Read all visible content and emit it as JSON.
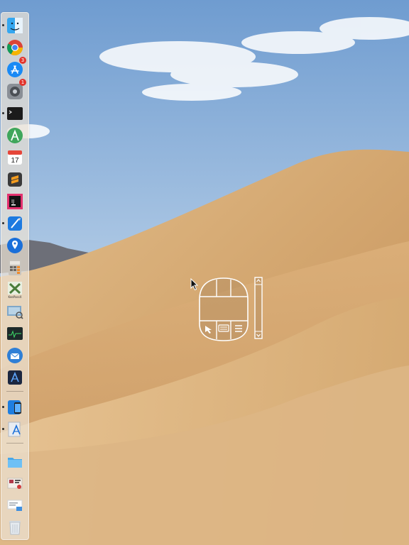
{
  "screen": {
    "wallpaper": "desert-dunes",
    "sky_color": "#8fb4d8",
    "sand_color": "#d7ad78"
  },
  "dock": {
    "items": [
      {
        "name": "finder",
        "icon": "finder-icon",
        "running": true
      },
      {
        "name": "chrome",
        "icon": "chrome-icon",
        "running": true
      },
      {
        "name": "app-store",
        "icon": "app-store-icon",
        "running": false,
        "badge": "3"
      },
      {
        "name": "system-preferences",
        "icon": "gear-icon",
        "running": false,
        "badge": "1"
      },
      {
        "name": "terminal",
        "icon": "terminal-icon",
        "running": true
      },
      {
        "name": "android-studio",
        "icon": "android-studio-icon",
        "running": false
      },
      {
        "name": "calendar",
        "icon": "calendar-icon",
        "running": false,
        "text": "17"
      },
      {
        "name": "sublime-text",
        "icon": "sublime-icon",
        "running": false
      },
      {
        "name": "intellij",
        "icon": "intellij-icon",
        "running": false
      },
      {
        "name": "xcode",
        "icon": "xcode-icon",
        "running": true
      },
      {
        "name": "maps-pin",
        "icon": "pin-icon",
        "running": false
      },
      {
        "name": "calculator",
        "icon": "calculator-icon",
        "running": false
      },
      {
        "name": "keypoint",
        "icon": "keypoint-icon",
        "running": false,
        "text": "KeePassX"
      },
      {
        "name": "preview",
        "icon": "preview-icon",
        "running": false
      },
      {
        "name": "activity-monitor",
        "icon": "activity-monitor-icon",
        "running": false
      },
      {
        "name": "thunderbird",
        "icon": "mail-icon",
        "running": false
      },
      {
        "name": "instruments",
        "icon": "instruments-icon",
        "running": false
      },
      {
        "name": "simulator",
        "icon": "simulator-icon",
        "running": true
      },
      {
        "name": "app-installer",
        "icon": "installer-icon",
        "running": true
      },
      {
        "name": "folder",
        "icon": "folder-icon",
        "running": false
      },
      {
        "name": "documents-stack",
        "icon": "documents-icon",
        "running": false
      },
      {
        "name": "downloads-stack",
        "icon": "downloads-icon",
        "running": false
      },
      {
        "name": "trash",
        "icon": "trash-icon",
        "running": false
      }
    ]
  },
  "overlay": {
    "buttons": [
      "pointer-icon",
      "keyboard-icon",
      "menu-icon"
    ],
    "scroll": [
      "chevron-up-icon",
      "chevron-down-icon"
    ]
  }
}
